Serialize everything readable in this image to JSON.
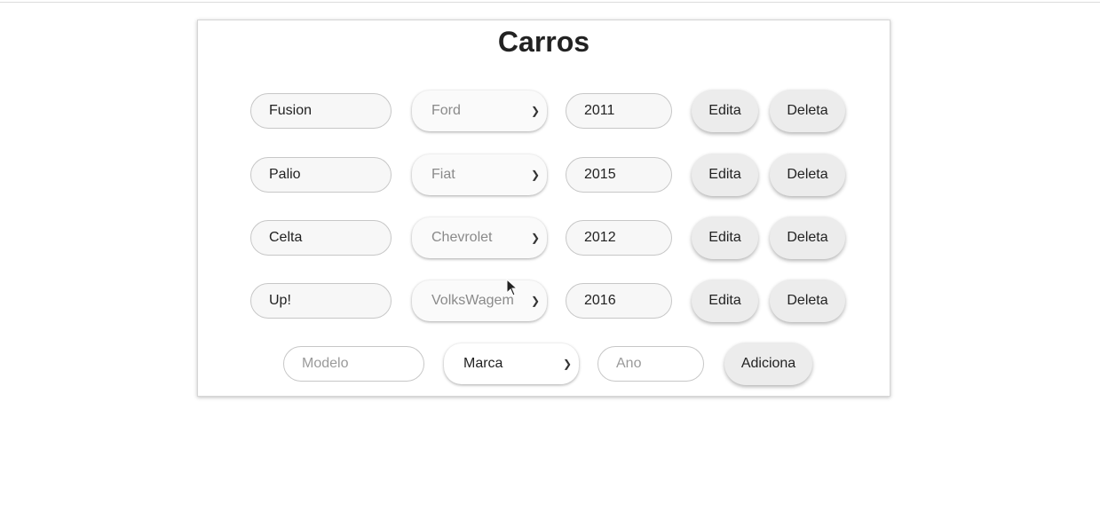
{
  "page": {
    "title": "Carros"
  },
  "cars": [
    {
      "modelo": "Fusion",
      "marca": "Ford",
      "ano": "2011",
      "edit_label": "Edita",
      "delete_label": "Deleta"
    },
    {
      "modelo": "Palio",
      "marca": "Fiat",
      "ano": "2015",
      "edit_label": "Edita",
      "delete_label": "Deleta"
    },
    {
      "modelo": "Celta",
      "marca": "Chevrolet",
      "ano": "2012",
      "edit_label": "Edita",
      "delete_label": "Deleta"
    },
    {
      "modelo": "Up!",
      "marca": "VolksWagem",
      "ano": "2016",
      "edit_label": "Edita",
      "delete_label": "Deleta"
    }
  ],
  "add_form": {
    "modelo_placeholder": "Modelo",
    "marca_selected": "Marca",
    "ano_placeholder": "Ano",
    "add_label": "Adiciona"
  },
  "icons": {
    "select_arrow": "chevron-down-icon",
    "cursor": "mouse-pointer-icon"
  }
}
